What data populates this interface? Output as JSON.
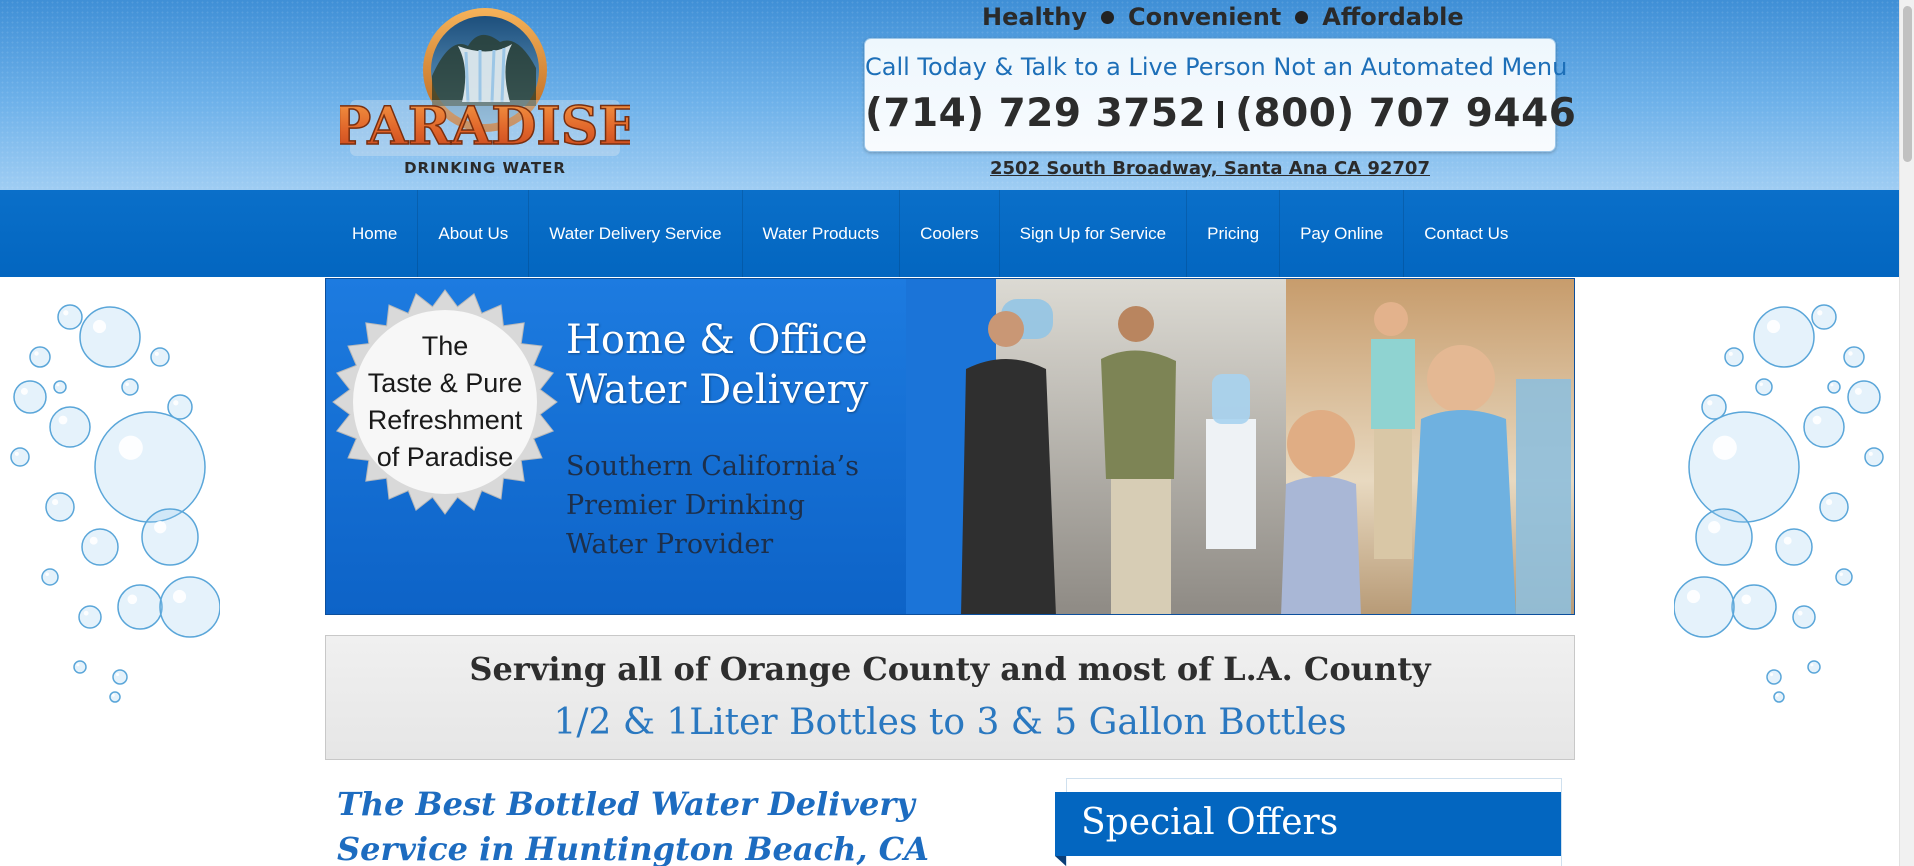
{
  "header": {
    "logo_text": "PARADISE",
    "logo_subtext": "DRINKING WATER",
    "taglines": [
      "Healthy",
      "Convenient",
      "Affordable"
    ],
    "call_text": "Call Today & Talk to a Live Person Not an Automated Menu",
    "phone_1": "(714) 729 3752",
    "phone_2": "(800) 707 9446",
    "address": "2502 South Broadway, Santa Ana CA 92707"
  },
  "nav": {
    "items": [
      {
        "label": "Home"
      },
      {
        "label": "About Us"
      },
      {
        "label": "Water Delivery Service"
      },
      {
        "label": "Water Products"
      },
      {
        "label": "Coolers"
      },
      {
        "label": "Sign Up for Service"
      },
      {
        "label": "Pricing"
      },
      {
        "label": "Pay Online"
      },
      {
        "label": "Contact Us"
      }
    ]
  },
  "hero": {
    "badge_lines": [
      "The",
      "Taste & Pure",
      "Refreshment",
      "of Paradise"
    ],
    "title_lines": [
      "Home & Office",
      "Water Delivery"
    ],
    "subtitle_lines": [
      "Southern California’s",
      "Premier Drinking",
      "Water Provider"
    ]
  },
  "serving": {
    "line1": "Serving all of Orange County and most of L.A. County",
    "line2": "1/2 & 1Liter Bottles to 3 & 5 Gallon Bottles"
  },
  "content": {
    "title": "The Best Bottled Water Delivery Service in Huntington Beach, CA"
  },
  "sidebar": {
    "offers_title": "Special Offers"
  },
  "colors": {
    "nav_blue": "#0366c0",
    "header_blue": "#4e9be0",
    "accent_text_blue": "#1d6cc0"
  }
}
